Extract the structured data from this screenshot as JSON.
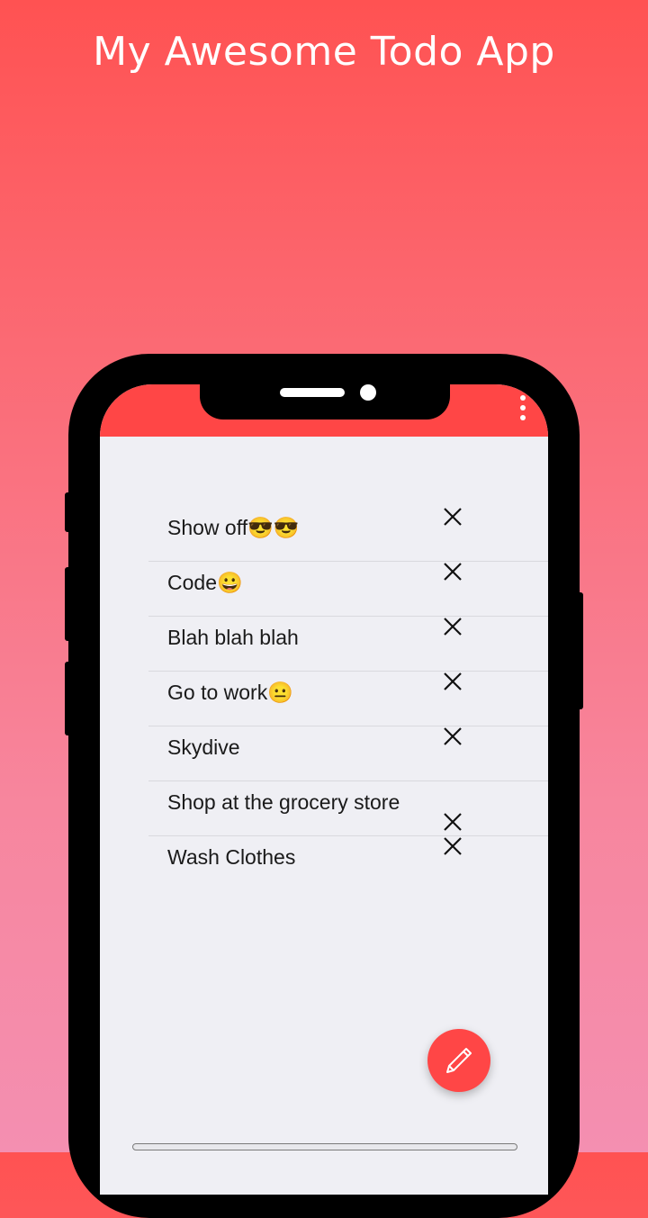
{
  "promo": {
    "title": "My Awesome Todo App"
  },
  "app": {
    "accent_color": "#ff4646",
    "menu_icon": "more-vert-icon"
  },
  "todos": [
    {
      "text": "Show off😎😎"
    },
    {
      "text": "Code😀"
    },
    {
      "text": "Blah blah blah"
    },
    {
      "text": "Go to work😐"
    },
    {
      "text": "Skydive"
    },
    {
      "text": "Shop at the grocery store"
    },
    {
      "text": "Wash Clothes"
    }
  ],
  "icons": {
    "delete": "close-icon",
    "fab": "pencil-icon"
  }
}
